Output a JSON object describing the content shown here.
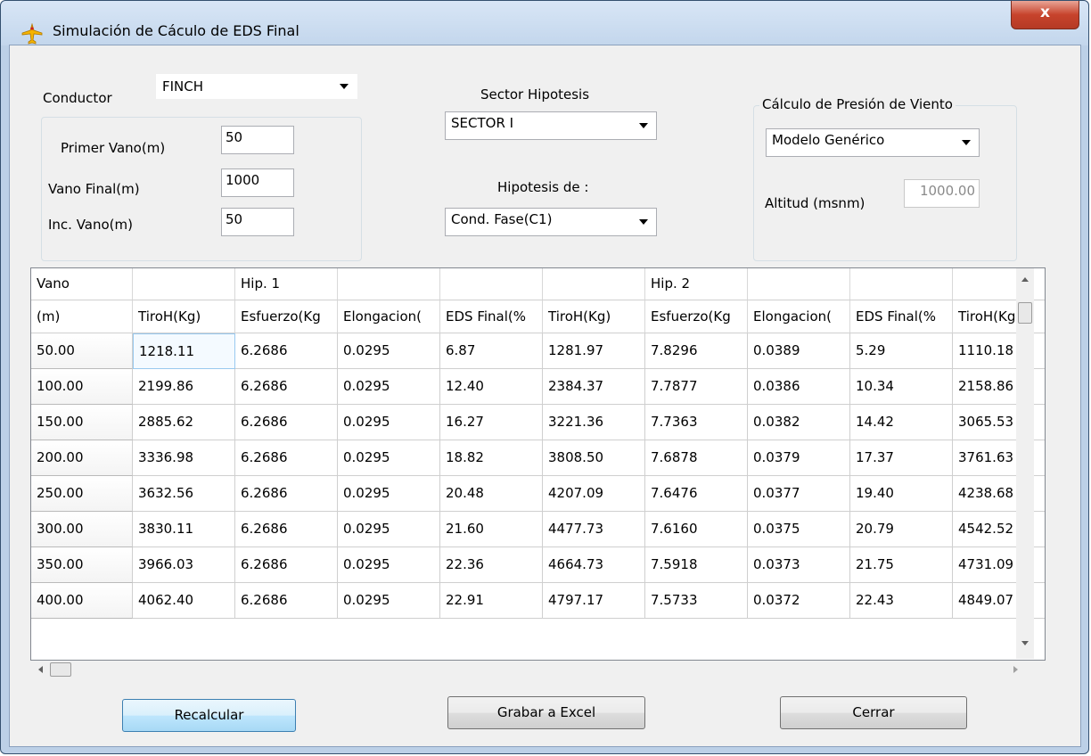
{
  "window": {
    "title": "Simulación de Cáculo de EDS Final",
    "close_label": "x"
  },
  "form": {
    "conductor_label": "Conductor",
    "conductor_value": "FINCH",
    "primer_vano_label": "Primer Vano(m)",
    "primer_vano_value": "50",
    "vano_final_label": "Vano Final(m)",
    "vano_final_value": "1000",
    "inc_vano_label": "Inc. Vano(m)",
    "inc_vano_value": "50",
    "sector_label": "Sector Hipotesis",
    "sector_value": "SECTOR I",
    "hipotesis_label": "Hipotesis de :",
    "hipotesis_value": "Cond. Fase(C1)",
    "viento_group_label": "Cálculo de Presión de Viento",
    "modelo_value": "Modelo Genérico",
    "altitud_label": "Altitud (msnm)",
    "altitud_value": "1000.00"
  },
  "grid": {
    "header_row1": [
      "Vano",
      "",
      "Hip. 1",
      "",
      "",
      "",
      "Hip. 2",
      "",
      "",
      ""
    ],
    "header_row2": [
      "(m)",
      "TiroH(Kg)",
      "Esfuerzo(Kg",
      "Elongacion(",
      "EDS Final(%",
      "TiroH(Kg)",
      "Esfuerzo(Kg",
      "Elongacion(",
      "EDS Final(%",
      "TiroH(Kg)"
    ],
    "rows": [
      [
        "50.00",
        "1218.11",
        "6.2686",
        "0.0295",
        "6.87",
        "1281.97",
        "7.8296",
        "0.0389",
        "5.29",
        "1110.18"
      ],
      [
        "100.00",
        "2199.86",
        "6.2686",
        "0.0295",
        "12.40",
        "2384.37",
        "7.7877",
        "0.0386",
        "10.34",
        "2158.86"
      ],
      [
        "150.00",
        "2885.62",
        "6.2686",
        "0.0295",
        "16.27",
        "3221.36",
        "7.7363",
        "0.0382",
        "14.42",
        "3065.53"
      ],
      [
        "200.00",
        "3336.98",
        "6.2686",
        "0.0295",
        "18.82",
        "3808.50",
        "7.6878",
        "0.0379",
        "17.37",
        "3761.63"
      ],
      [
        "250.00",
        "3632.56",
        "6.2686",
        "0.0295",
        "20.48",
        "4207.09",
        "7.6476",
        "0.0377",
        "19.40",
        "4238.68"
      ],
      [
        "300.00",
        "3830.11",
        "6.2686",
        "0.0295",
        "21.60",
        "4477.73",
        "7.6160",
        "0.0375",
        "20.79",
        "4542.52"
      ],
      [
        "350.00",
        "3966.03",
        "6.2686",
        "0.0295",
        "22.36",
        "4664.73",
        "7.5918",
        "0.0373",
        "21.75",
        "4731.09"
      ],
      [
        "400.00",
        "4062.40",
        "6.2686",
        "0.0295",
        "22.91",
        "4797.17",
        "7.5733",
        "0.0372",
        "22.43",
        "4849.07"
      ]
    ]
  },
  "buttons": {
    "recalcular": "Recalcular",
    "grabar": "Grabar a Excel",
    "cerrar": "Cerrar"
  },
  "icons": {
    "app": "airplane-icon",
    "close": "close-icon"
  },
  "colors": {
    "title_bar": "#c3d6ec",
    "close_button": "#c7432c",
    "focused_button": "#bee6fd",
    "selected_cell_border": "#99c9ef"
  }
}
